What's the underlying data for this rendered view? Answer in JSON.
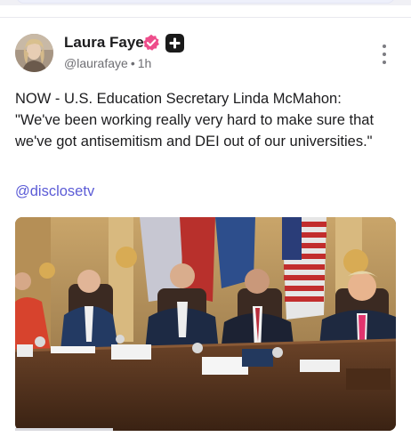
{
  "post": {
    "author_name": "Laura Faye",
    "handle": "@laurafaye",
    "separator": "•",
    "time": "1h",
    "body": "NOW - U.S. Education Secretary Linda McMahon: \"We've been working really very hard to make sure that we've got antisemitism and DEI out of our universities.\"",
    "mention": "@disclosetv",
    "verified_color": "#ee4d8b",
    "link_color": "#5b5bd6",
    "icons": {
      "avatar": "user-avatar",
      "verified": "verified-badge-icon",
      "plus": "plus-badge-icon",
      "more": "more-vertical-icon"
    }
  },
  "media": {
    "type": "video-thumbnail",
    "description_icon": "video-frame"
  }
}
